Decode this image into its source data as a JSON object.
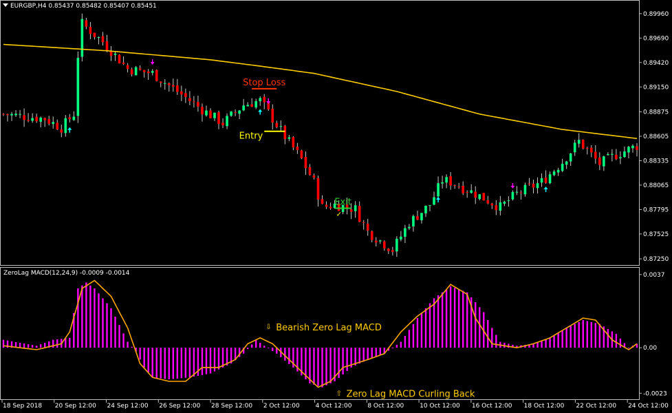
{
  "window": {
    "title": "EURGBP,H4  0.85437 0.85482 0.85407 0.85451"
  },
  "colors": {
    "background": "#000000",
    "bull": "#00ff7f",
    "bear": "#ff0000",
    "ma": "#ffcc00",
    "macd_hist": "#ff00ff",
    "macd_signal": "#ffa500",
    "arrow_up": "#00ffff",
    "arrow_down": "#ff00ff",
    "stop_loss": "#ff3300",
    "entry": "#ffff00",
    "exit": "#33cc33"
  },
  "chart_data": [
    {
      "type": "candlestick",
      "title": "EURGBP,H4  0.85437 0.85482 0.85407 0.85451",
      "price_ticks": [
        "0.89960",
        "0.89690",
        "0.89420",
        "0.89150",
        "0.88875",
        "0.88605",
        "0.88335",
        "0.88065",
        "0.87795",
        "0.87525",
        "0.87250"
      ],
      "ylim": [
        0.8722,
        0.9005
      ],
      "x_ticks": [
        "18 Sep 2018",
        "20 Sep 12:00",
        "24 Sep 12:00",
        "26 Sep 12:00",
        "28 Sep 12:00",
        "2 Oct 12:00",
        "4 Oct 12:00",
        "8 Oct 12:00",
        "10 Oct 12:00",
        "16 Oct 12:00",
        "18 Oct 12:00",
        "22 Oct 12:00",
        "24 Oct 12:00"
      ],
      "candle_count": 154,
      "close_path_anchors": [
        [
          0,
          0.8885
        ],
        [
          10,
          0.888
        ],
        [
          14,
          0.887
        ],
        [
          17,
          0.8885
        ],
        [
          18,
          0.895
        ],
        [
          19,
          0.8985
        ],
        [
          24,
          0.8965
        ],
        [
          30,
          0.8935
        ],
        [
          36,
          0.893
        ],
        [
          42,
          0.891
        ],
        [
          48,
          0.889
        ],
        [
          53,
          0.8875
        ],
        [
          58,
          0.8895
        ],
        [
          62,
          0.89
        ],
        [
          65,
          0.888
        ],
        [
          68,
          0.886
        ],
        [
          72,
          0.8835
        ],
        [
          75,
          0.881
        ],
        [
          77,
          0.8782
        ],
        [
          80,
          0.8785
        ],
        [
          85,
          0.878
        ],
        [
          88,
          0.8755
        ],
        [
          94,
          0.8735
        ],
        [
          98,
          0.8765
        ],
        [
          103,
          0.8785
        ],
        [
          106,
          0.8812
        ],
        [
          108,
          0.881
        ],
        [
          114,
          0.8797
        ],
        [
          120,
          0.8782
        ],
        [
          124,
          0.8797
        ],
        [
          130,
          0.881
        ],
        [
          135,
          0.8832
        ],
        [
          139,
          0.8855
        ],
        [
          144,
          0.883
        ],
        [
          148,
          0.884
        ],
        [
          153,
          0.885
        ]
      ],
      "moving_average_anchors": [
        [
          0,
          0.8962
        ],
        [
          25,
          0.8955
        ],
        [
          50,
          0.8945
        ],
        [
          62,
          0.8938
        ],
        [
          75,
          0.893
        ],
        [
          95,
          0.891
        ],
        [
          115,
          0.8885
        ],
        [
          135,
          0.8868
        ],
        [
          153,
          0.8858
        ]
      ],
      "signal_arrows": [
        {
          "index": 16,
          "dir": "up"
        },
        {
          "index": 36,
          "dir": "down"
        },
        {
          "index": 62,
          "dir": "up"
        },
        {
          "index": 64,
          "dir": "down"
        },
        {
          "index": 105,
          "dir": "up"
        },
        {
          "index": 123,
          "dir": "down"
        },
        {
          "index": 131,
          "dir": "up"
        }
      ],
      "annotations": [
        {
          "label": "Stop Loss",
          "price": 0.8913,
          "from": 60,
          "to": 66,
          "color": "#ff3300"
        },
        {
          "label": "Entry",
          "price": 0.8866,
          "from": 63,
          "to": 68,
          "color": "#ffff00"
        },
        {
          "label": "Exit",
          "price": 0.8781,
          "from": 80,
          "to": 84,
          "color": "#33cc33",
          "check": true
        }
      ]
    },
    {
      "type": "bar",
      "title": "ZeroLag MACD(12,24,9) -0.0009 -0.0014",
      "ticks": [
        "0.0037",
        "0.00",
        "-0.0023"
      ],
      "ylim": [
        -0.0025,
        0.0038
      ],
      "histogram_anchors": [
        [
          0,
          0.0004
        ],
        [
          8,
          0.0001
        ],
        [
          12,
          0.0004
        ],
        [
          16,
          0.0005
        ],
        [
          18,
          0.003
        ],
        [
          20,
          0.0033
        ],
        [
          22,
          0.003
        ],
        [
          26,
          0.002
        ],
        [
          30,
          0.0003
        ],
        [
          32,
          -0.0002
        ],
        [
          34,
          -0.001
        ],
        [
          36,
          -0.0015
        ],
        [
          40,
          -0.0016
        ],
        [
          45,
          -0.0015
        ],
        [
          50,
          -0.0013
        ],
        [
          55,
          -0.0008
        ],
        [
          58,
          -0.0003
        ],
        [
          61,
          0.0004
        ],
        [
          63,
          0.0001
        ],
        [
          66,
          -0.0003
        ],
        [
          70,
          -0.001
        ],
        [
          74,
          -0.0018
        ],
        [
          77,
          -0.002
        ],
        [
          80,
          -0.0017
        ],
        [
          84,
          -0.001
        ],
        [
          88,
          -0.0006
        ],
        [
          92,
          -0.0003
        ],
        [
          96,
          0.0003
        ],
        [
          100,
          0.0015
        ],
        [
          104,
          0.0025
        ],
        [
          108,
          0.0031
        ],
        [
          112,
          0.0028
        ],
        [
          116,
          0.0018
        ],
        [
          118,
          0.001
        ],
        [
          120,
          0.0003
        ],
        [
          124,
          0.0001
        ],
        [
          128,
          0.0002
        ],
        [
          132,
          0.0005
        ],
        [
          136,
          0.001
        ],
        [
          140,
          0.0014
        ],
        [
          144,
          0.0012
        ],
        [
          148,
          0.0007
        ],
        [
          151,
          0.0
        ],
        [
          153,
          0.0002
        ]
      ],
      "signal_anchors": [
        [
          0,
          0.0001
        ],
        [
          8,
          -0.0001
        ],
        [
          14,
          0.0002
        ],
        [
          16,
          0.0008
        ],
        [
          19,
          0.003
        ],
        [
          22,
          0.0034
        ],
        [
          26,
          0.0026
        ],
        [
          30,
          0.001
        ],
        [
          33,
          -0.0008
        ],
        [
          36,
          -0.0015
        ],
        [
          40,
          -0.0017
        ],
        [
          44,
          -0.0017
        ],
        [
          48,
          -0.001
        ],
        [
          52,
          -0.001
        ],
        [
          56,
          -0.0006
        ],
        [
          59,
          0.0002
        ],
        [
          62,
          0.0005
        ],
        [
          65,
          0.0002
        ],
        [
          68,
          -0.0004
        ],
        [
          72,
          -0.0012
        ],
        [
          76,
          -0.002
        ],
        [
          79,
          -0.0017
        ],
        [
          82,
          -0.001
        ],
        [
          88,
          -0.0006
        ],
        [
          92,
          -0.0003
        ],
        [
          96,
          0.0008
        ],
        [
          100,
          0.0016
        ],
        [
          104,
          0.0022
        ],
        [
          108,
          0.0032
        ],
        [
          112,
          0.0027
        ],
        [
          114,
          0.0015
        ],
        [
          118,
          0.0002
        ],
        [
          124,
          0.0
        ],
        [
          128,
          0.0002
        ],
        [
          132,
          0.0005
        ],
        [
          136,
          0.001
        ],
        [
          140,
          0.0015
        ],
        [
          143,
          0.0014
        ],
        [
          147,
          0.0004
        ],
        [
          151,
          -0.0001
        ],
        [
          153,
          0.0002
        ]
      ],
      "annotations": [
        {
          "label": "Bearish Zero Lag MACD",
          "index": 64,
          "value": 0.0006,
          "arrow": "⇩",
          "color": "#ffcc00"
        },
        {
          "label": "Zero Lag MACD Curling Back",
          "index": 81,
          "value": -0.002,
          "arrow": "⇧",
          "color": "#ffcc00"
        }
      ]
    }
  ]
}
